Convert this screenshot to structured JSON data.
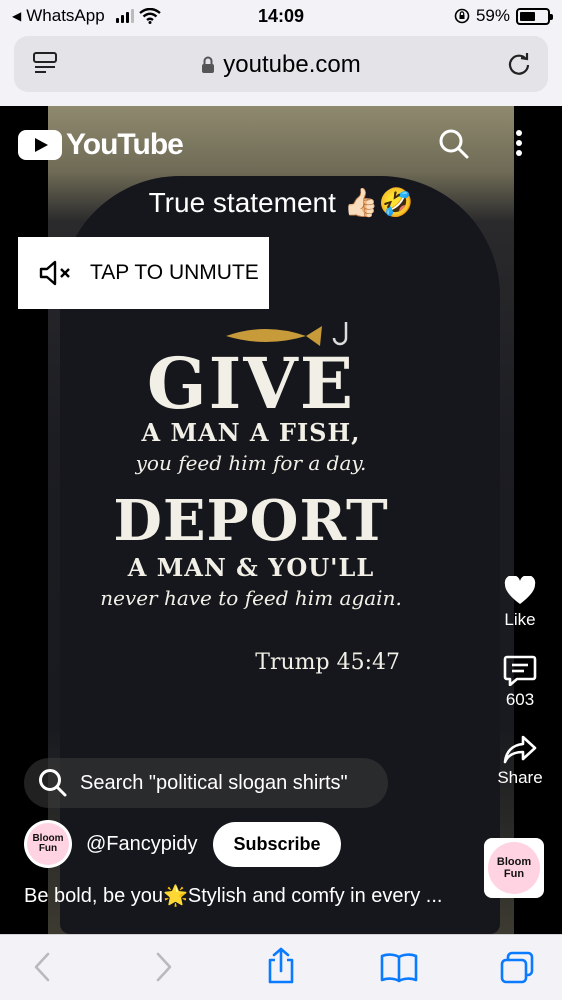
{
  "status_bar": {
    "back_app": "WhatsApp",
    "time": "14:09",
    "battery": "59%",
    "battery_level": 0.59
  },
  "browser": {
    "url": "youtube.com"
  },
  "player": {
    "brand": "YouTube",
    "caption": "True statement 👍🏻🤣",
    "unmute_label": "TAP TO UNMUTE",
    "shirt_text": {
      "line1": "GIVE",
      "line2": "A MAN A FISH,",
      "line3": "you feed him for a day.",
      "line4": "DEPORT",
      "line5": "A MAN & YOU'LL",
      "line6": "never have to feed him again.",
      "line7": "Trump 45:47"
    }
  },
  "actions": {
    "like_label": "Like",
    "comments_count": "603",
    "share_label": "Share"
  },
  "search_suggestion": "Search \"political slogan shirts\"",
  "channel": {
    "name": "@Fancypidy",
    "avatar_text": "Bloom Fun",
    "subscribe_label": "Subscribe"
  },
  "description": "Be bold, be you🌟Stylish and comfy in every ...",
  "colors": {
    "youtube_red": "#ff0000",
    "ios_blue": "#0a7aff",
    "toolbar_bg": "#f2f2f7"
  }
}
